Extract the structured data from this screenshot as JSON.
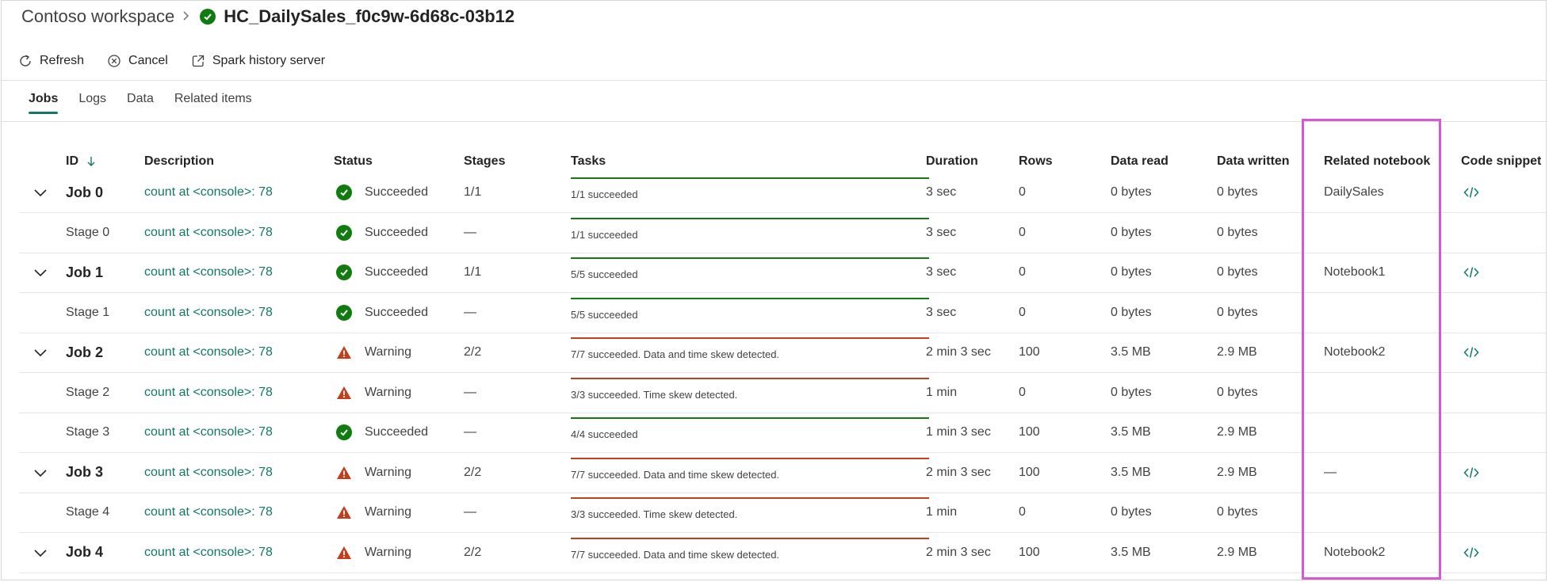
{
  "breadcrumb": {
    "root": "Contoso workspace",
    "title": "HC_DailySales_f0c9w-6d68c-03b12"
  },
  "toolbar": {
    "refresh": "Refresh",
    "cancel": "Cancel",
    "spark_history": "Spark history server"
  },
  "tabs": [
    {
      "label": "Jobs",
      "active": true
    },
    {
      "label": "Logs",
      "active": false
    },
    {
      "label": "Data",
      "active": false
    },
    {
      "label": "Related items",
      "active": false
    }
  ],
  "columns": {
    "id": "ID",
    "description": "Description",
    "status": "Status",
    "stages": "Stages",
    "tasks": "Tasks",
    "duration": "Duration",
    "rows": "Rows",
    "data_read": "Data read",
    "data_written": "Data written",
    "related_notebook": "Related notebook",
    "code_snippet": "Code snippet"
  },
  "colors": {
    "accent": "#117865",
    "success": "#107c10",
    "warning": "#c43e1c",
    "highlight": "#d35ad3"
  },
  "rows": [
    {
      "type": "job",
      "id": "Job 0",
      "description": "count at <console>: 78",
      "status": "Succeeded",
      "status_type": "success",
      "stages": "1/1",
      "tasks": "1/1 succeeded",
      "duration": "3 sec",
      "rows": "0",
      "data_read": "0 bytes",
      "data_written": "0 bytes",
      "notebook": "DailySales",
      "code": true
    },
    {
      "type": "stage",
      "id": "Stage 0",
      "description": "count at <console>: 78",
      "status": "Succeeded",
      "status_type": "success",
      "stages": "—",
      "tasks": "1/1 succeeded",
      "duration": "3 sec",
      "rows": "0",
      "data_read": "0 bytes",
      "data_written": "0 bytes",
      "notebook": "",
      "code": false
    },
    {
      "type": "job",
      "id": "Job 1",
      "description": "count at <console>: 78",
      "status": "Succeeded",
      "status_type": "success",
      "stages": "1/1",
      "tasks": "5/5 succeeded",
      "duration": "3 sec",
      "rows": "0",
      "data_read": "0 bytes",
      "data_written": "0 bytes",
      "notebook": "Notebook1",
      "code": true
    },
    {
      "type": "stage",
      "id": "Stage 1",
      "description": "count at <console>: 78",
      "status": "Succeeded",
      "status_type": "success",
      "stages": "—",
      "tasks": "5/5 succeeded",
      "duration": "3 sec",
      "rows": "0",
      "data_read": "0 bytes",
      "data_written": "0 bytes",
      "notebook": "",
      "code": false
    },
    {
      "type": "job",
      "id": "Job 2",
      "description": "count at <console>: 78",
      "status": "Warning",
      "status_type": "warning",
      "stages": "2/2",
      "tasks": "7/7 succeeded. Data and time skew detected.",
      "duration": "2 min 3 sec",
      "rows": "100",
      "data_read": "3.5 MB",
      "data_written": "2.9 MB",
      "notebook": "Notebook2",
      "code": true
    },
    {
      "type": "stage",
      "id": "Stage 2",
      "description": "count at <console>: 78",
      "status": "Warning",
      "status_type": "warning",
      "stages": "—",
      "tasks": "3/3 succeeded. Time skew detected.",
      "duration": "1 min",
      "rows": "0",
      "data_read": "0 bytes",
      "data_written": "0 bytes",
      "notebook": "",
      "code": false
    },
    {
      "type": "stage",
      "id": "Stage 3",
      "description": "count at <console>: 78",
      "status": "Succeeded",
      "status_type": "success",
      "stages": "—",
      "tasks": "4/4 succeeded",
      "duration": "1 min 3 sec",
      "rows": "100",
      "data_read": "3.5 MB",
      "data_written": "2.9 MB",
      "notebook": "",
      "code": false
    },
    {
      "type": "job",
      "id": "Job 3",
      "description": "count at <console>: 78",
      "status": "Warning",
      "status_type": "warning",
      "stages": "2/2",
      "tasks": "7/7 succeeded. Data and time skew detected.",
      "duration": "2 min 3 sec",
      "rows": "100",
      "data_read": "3.5 MB",
      "data_written": "2.9 MB",
      "notebook": "—",
      "code": true
    },
    {
      "type": "stage",
      "id": "Stage 4",
      "description": "count at <console>: 78",
      "status": "Warning",
      "status_type": "warning",
      "stages": "—",
      "tasks": "3/3 succeeded. Time skew detected.",
      "duration": "1 min",
      "rows": "0",
      "data_read": "0 bytes",
      "data_written": "0 bytes",
      "notebook": "",
      "code": false
    },
    {
      "type": "job",
      "id": "Job 4",
      "description": "count at <console>: 78",
      "status": "Warning",
      "status_type": "warning",
      "stages": "2/2",
      "tasks": "7/7 succeeded. Data and time skew detected.",
      "duration": "2 min 3 sec",
      "rows": "100",
      "data_read": "3.5 MB",
      "data_written": "2.9 MB",
      "notebook": "Notebook2",
      "code": true
    }
  ]
}
